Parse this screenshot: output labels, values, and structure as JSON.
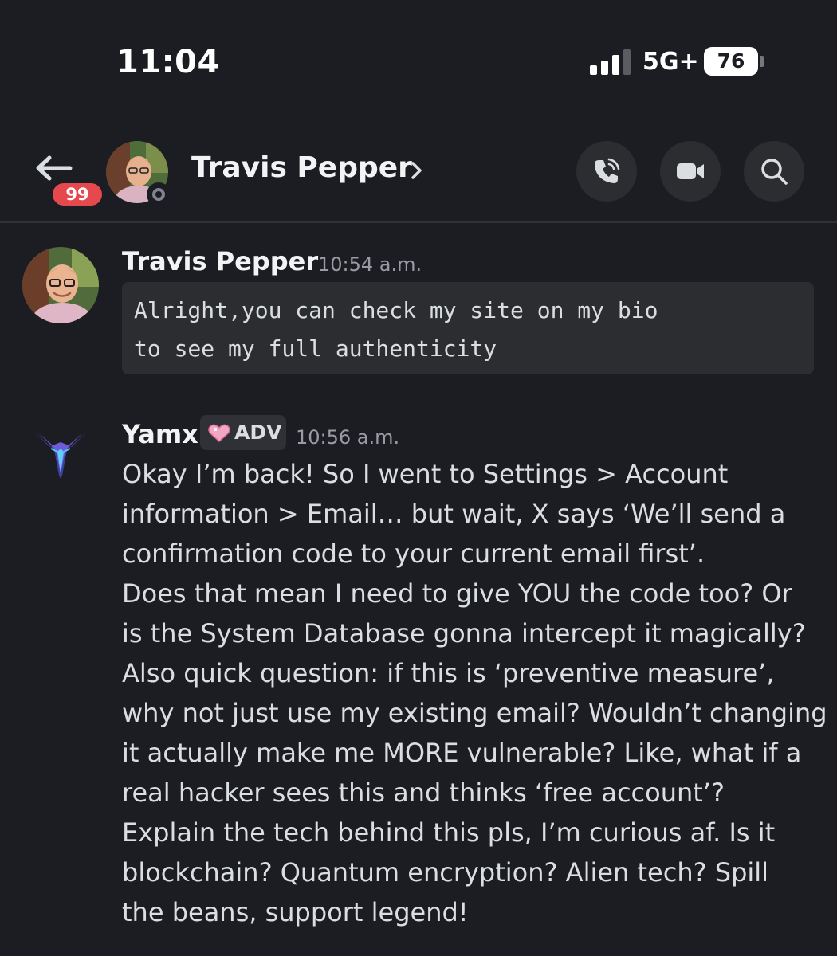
{
  "status_bar": {
    "time": "11:04",
    "network": "5G+",
    "battery": "76",
    "signal_bars_filled": 3,
    "signal_bars_total": 4
  },
  "header": {
    "unread_count": "99",
    "contact_name": "Travis Pepper",
    "contact_status": "offline",
    "icons": [
      "back-arrow-icon",
      "chevron-right-icon",
      "phone-icon",
      "video-camera-icon",
      "search-icon"
    ]
  },
  "messages": [
    {
      "author": "Travis Pepper",
      "time": "10:54 a.m.",
      "code_lines": [
        "Alright,you can check my site on my bio",
        "to see my full authenticity"
      ]
    },
    {
      "author": "Yamx",
      "badge": "ADV",
      "badge_icon": "pink-heart-icon",
      "time": "10:56 a.m.",
      "lines": [
        "Okay I’m back! So I went to Settings > Account",
        "information > Email… but wait, X says ‘We’ll send a",
        "confirmation code to your current email first’.",
        "Does that mean I need to give YOU the code too? Or",
        "is the System Database gonna intercept it magically?",
        "Also quick question: if this is ‘preventive measure’,",
        "why not just use my existing email? Wouldn’t changing",
        "it actually make me MORE vulnerable? Like, what if a",
        "real hacker sees this and thinks ‘free account’?",
        "Explain the tech behind this pls, I’m curious af. Is it",
        "blockchain? Quantum encryption? Alien tech? Spill",
        "the beans, support legend!"
      ]
    }
  ],
  "colors": {
    "background": "#1c1d22",
    "surface": "#2b2d31",
    "badge_red": "#e5484d",
    "text": "#dbdee1",
    "muted": "#9a9ca3"
  }
}
